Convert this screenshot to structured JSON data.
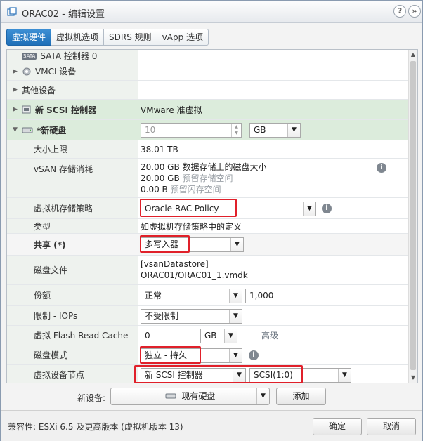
{
  "window": {
    "title": "ORAC02 - 编辑设置",
    "help_glyph": "?",
    "close_glyph": "»"
  },
  "tabs": [
    {
      "label": "虚拟硬件",
      "active": true
    },
    {
      "label": "虚拟机选项",
      "active": false
    },
    {
      "label": "SDRS 规则",
      "active": false
    },
    {
      "label": "vApp 选项",
      "active": false
    }
  ],
  "rows": {
    "sata": {
      "label": "SATA 控制器 0",
      "icon": "sata-icon",
      "icon_text": "SATA"
    },
    "vmci": {
      "label": "VMCI 设备",
      "icon": "gear-icon"
    },
    "other": {
      "label": "其他设备"
    },
    "scsi": {
      "label": "新 SCSI 控制器",
      "value": "VMware 准虚拟",
      "icon": "scsi-controller-icon"
    },
    "disk": {
      "label": "*新硬盘",
      "size_value": "10",
      "size_unit": "GB",
      "icon": "hard-disk-icon"
    },
    "max_size": {
      "label": "大小上限",
      "value": "38.01 TB"
    },
    "vsan": {
      "label": "vSAN 存储消耗",
      "line1": "20.00 GB 数据存储上的磁盘大小",
      "line2a": "20.00 GB ",
      "line2b": "预留存储空间",
      "line3a": "0.00 B ",
      "line3b": "预留闪存空间"
    },
    "policy": {
      "label": "虚拟机存储策略",
      "value": "Oracle RAC Policy"
    },
    "type": {
      "label": "类型",
      "value": "如虚拟机存储策略中的定义"
    },
    "sharing": {
      "label": "共享 (*)",
      "value": "多写入器"
    },
    "disk_file": {
      "label": "磁盘文件",
      "line1": "[vsanDatastore]",
      "line2": "ORAC01/ORAC01_1.vmdk"
    },
    "shares": {
      "label": "份额",
      "value": "正常",
      "number": "1,000"
    },
    "limit": {
      "label": "限制 - IOPs",
      "value": "不受限制"
    },
    "flash": {
      "label": "虚拟 Flash Read Cache",
      "value": "0",
      "unit": "GB",
      "advanced": "高级"
    },
    "mode": {
      "label": "磁盘模式",
      "value": "独立 - 持久"
    },
    "node": {
      "label": "虚拟设备节点",
      "controller": "新 SCSI 控制器",
      "slot": "SCSI(1:0)"
    }
  },
  "new_device": {
    "label": "新设备:",
    "selected": "现有硬盘",
    "add_button": "添加"
  },
  "footer": {
    "compatibility": "兼容性: ESXi 6.5 及更高版本 (虚拟机版本 13)",
    "ok": "确定",
    "cancel": "取消"
  },
  "colors": {
    "tab_active": "#2a7cc4",
    "highlight": "#e0202a",
    "selected_row": "#dcecdc"
  }
}
